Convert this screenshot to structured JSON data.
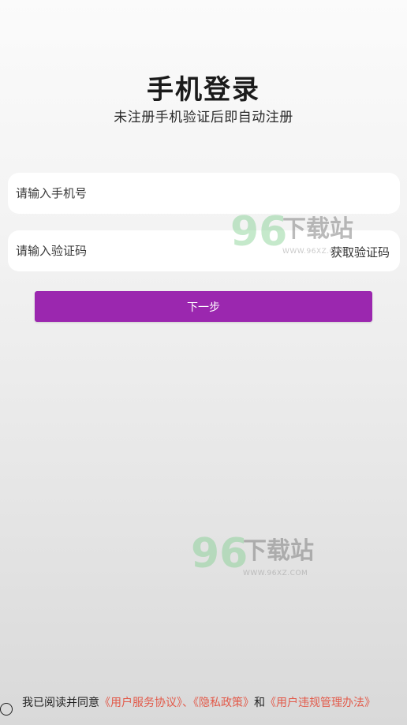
{
  "header": {
    "title": "手机登录",
    "subtitle": "未注册手机验证后即自动注册"
  },
  "form": {
    "phone_placeholder": "请输入手机号",
    "code_placeholder": "请输入验证码",
    "get_code_label": "获取验证码",
    "next_label": "下一步"
  },
  "watermark": {
    "number": "96",
    "text": "下载站",
    "url": "WWW.96XZ.COM"
  },
  "agreement": {
    "prefix": "我已阅读并同意",
    "link_service": "《用户服务协议》",
    "sep1": "、",
    "link_privacy": "《隐私政策》",
    "sep2": "和",
    "link_rules": "《用户违规管理办法》"
  },
  "colors": {
    "accent": "#9b27af",
    "link": "#e25a4a"
  }
}
